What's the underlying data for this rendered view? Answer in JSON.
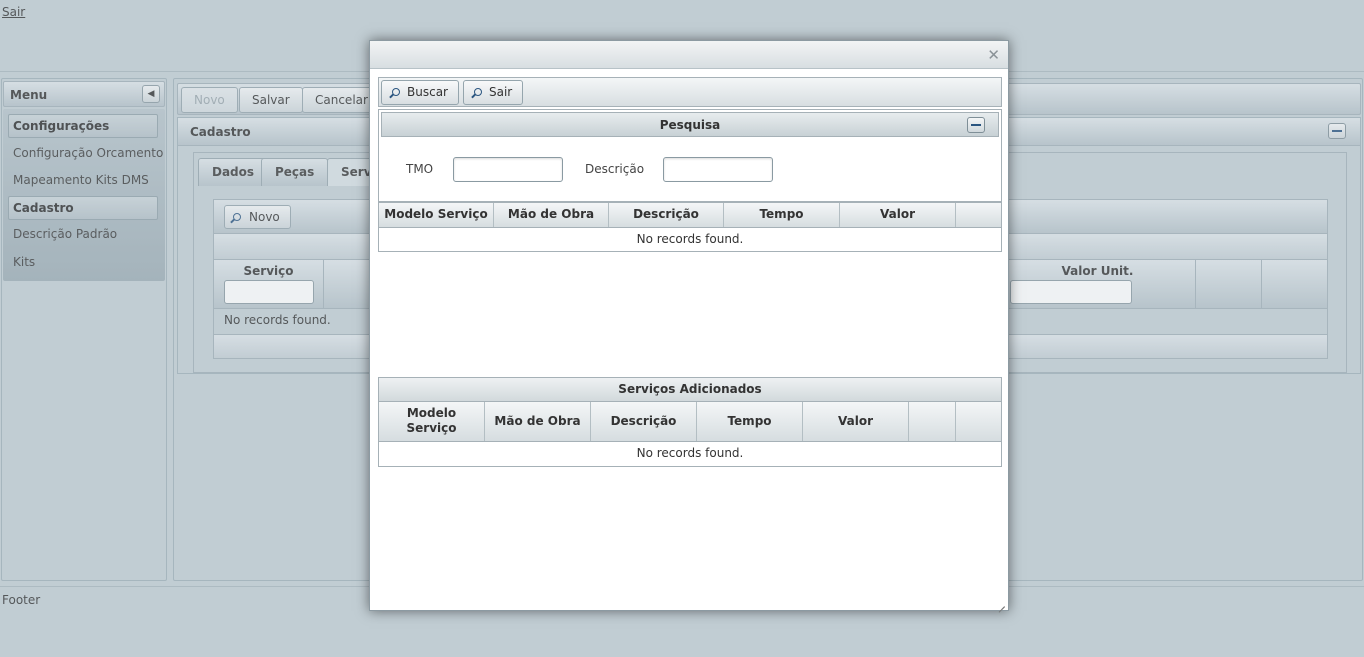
{
  "header": {
    "logout_label": "Sair"
  },
  "footer": {
    "text": "Footer"
  },
  "menu": {
    "title": "Menu",
    "categories": [
      {
        "label": "Configurações",
        "items": [
          "Configuração Orcamento",
          "Mapeamento Kits DMS"
        ]
      },
      {
        "label": "Cadastro",
        "items": [
          "Descrição Padrão",
          "Kits"
        ]
      }
    ]
  },
  "toolbar": {
    "novo": "Novo",
    "salvar": "Salvar",
    "cancelar": "Cancelar"
  },
  "cadastro": {
    "title": "Cadastro",
    "tabs": [
      "Dados",
      "Peças",
      "Servi"
    ],
    "inner": {
      "novo_label": "Novo",
      "col_servico": "Serviço",
      "col_valor_unit": "Valor Unit.",
      "empty": "No records found."
    }
  },
  "dialog": {
    "toolbar": {
      "buscar": "Buscar",
      "sair": "Sair"
    },
    "pesquisa": {
      "title": "Pesquisa",
      "tmo_label": "TMO",
      "tmo_value": "",
      "descricao_label": "Descrição",
      "descricao_value": ""
    },
    "results": {
      "columns": [
        "Modelo Serviço",
        "Mão de Obra",
        "Descrição",
        "Tempo",
        "Valor"
      ],
      "empty": "No records found."
    },
    "added": {
      "title": "Serviços Adicionados",
      "columns": [
        "Modelo Serviço",
        "Mão de Obra",
        "Descrição",
        "Tempo",
        "Valor"
      ],
      "empty": "No records found."
    }
  }
}
